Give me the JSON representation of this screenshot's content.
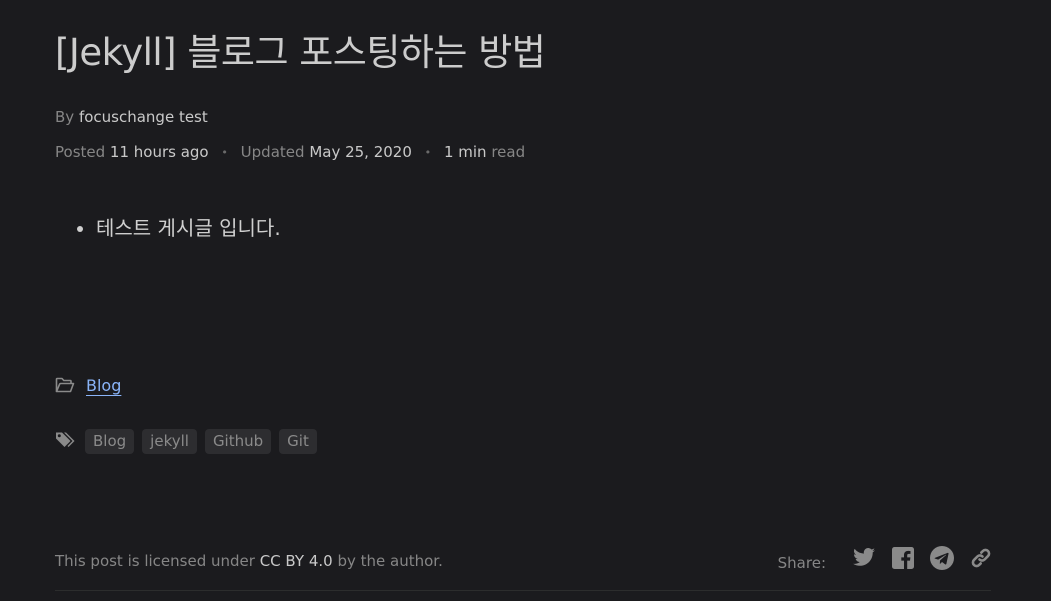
{
  "post": {
    "title": "[Jekyll] 블로그 포스팅하는 방법",
    "by_label": "By",
    "author": "focuschange test",
    "posted_label": "Posted",
    "posted_value": "11 hours ago",
    "updated_label": "Updated",
    "updated_value": "May 25, 2020",
    "read_count": "1 min",
    "read_label": "read",
    "separator": "•",
    "content": [
      "테스트 게시글 입니다."
    ]
  },
  "category": {
    "icon": "folder-open-icon",
    "label": "Blog"
  },
  "tags": {
    "icon": "tags-icon",
    "items": [
      "Blog",
      "jekyll",
      "Github",
      "Git"
    ]
  },
  "footer": {
    "license_prefix": "This post is licensed under",
    "license_link": "CC BY 4.0",
    "license_suffix": "by the author.",
    "share_label": "Share:",
    "share_icons": [
      "twitter-icon",
      "facebook-icon",
      "telegram-icon",
      "link-icon"
    ]
  },
  "colors": {
    "background": "#1b1b1e",
    "link": "#8ab4f8",
    "tag_bg": "#2d2d30"
  }
}
